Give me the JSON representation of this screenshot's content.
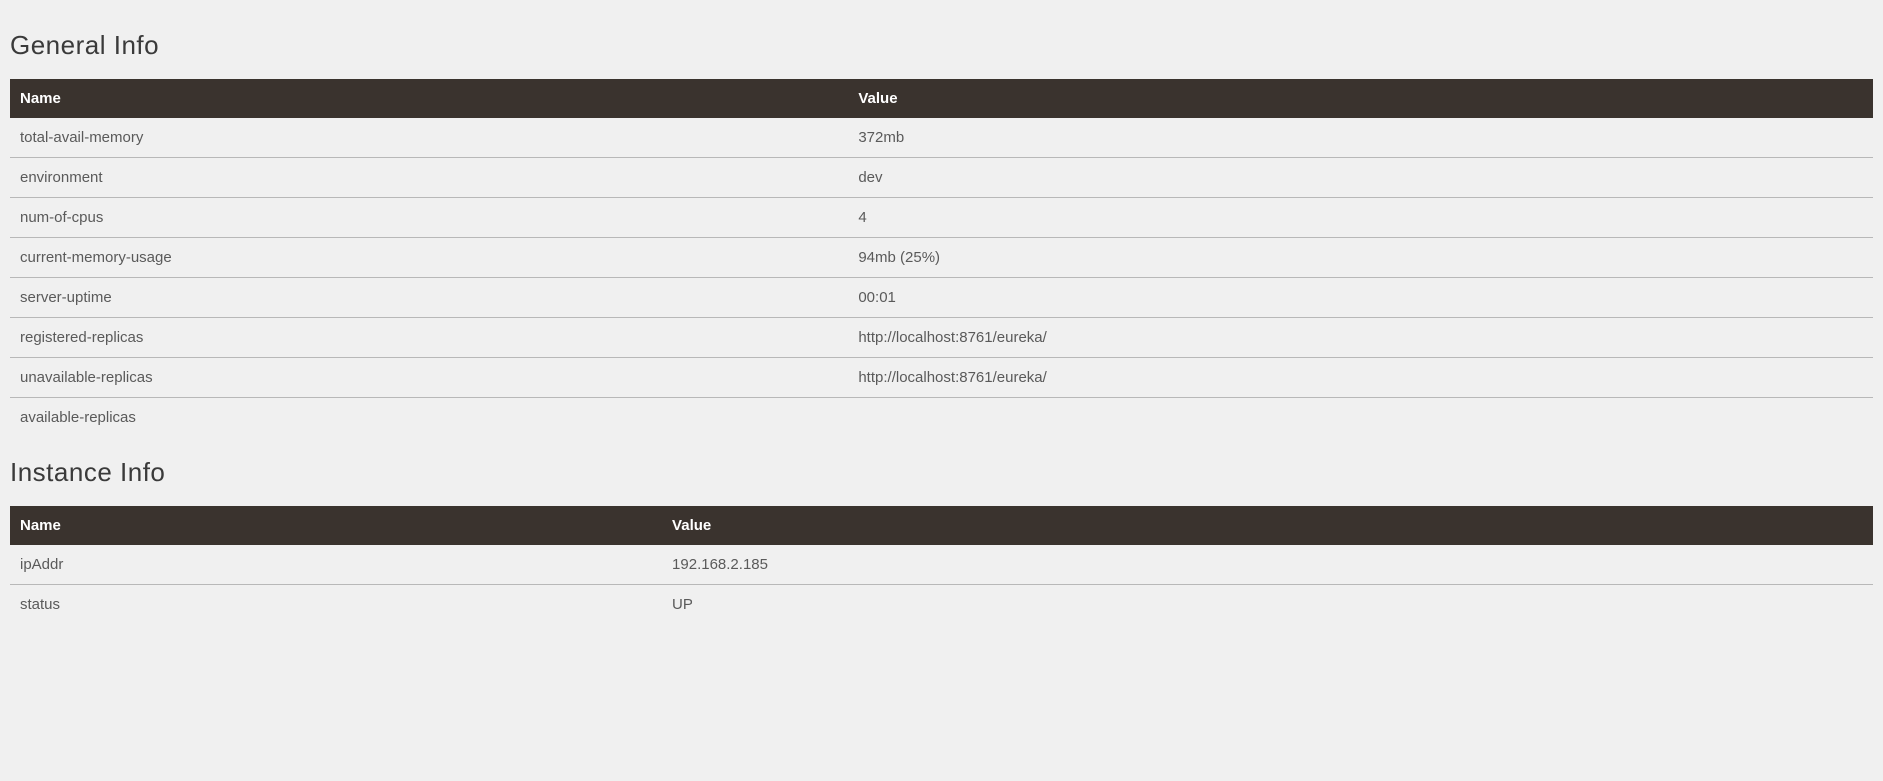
{
  "general": {
    "title": "General Info",
    "headers": {
      "name": "Name",
      "value": "Value"
    },
    "rows": [
      {
        "name": "total-avail-memory",
        "value": "372mb"
      },
      {
        "name": "environment",
        "value": "dev"
      },
      {
        "name": "num-of-cpus",
        "value": "4"
      },
      {
        "name": "current-memory-usage",
        "value": "94mb (25%)"
      },
      {
        "name": "server-uptime",
        "value": "00:01"
      },
      {
        "name": "registered-replicas",
        "value": "http://localhost:8761/eureka/"
      },
      {
        "name": "unavailable-replicas",
        "value": "http://localhost:8761/eureka/"
      },
      {
        "name": "available-replicas",
        "value": ""
      }
    ]
  },
  "instance": {
    "title": "Instance Info",
    "headers": {
      "name": "Name",
      "value": "Value"
    },
    "rows": [
      {
        "name": "ipAddr",
        "value": "192.168.2.185"
      },
      {
        "name": "status",
        "value": "UP"
      }
    ]
  }
}
